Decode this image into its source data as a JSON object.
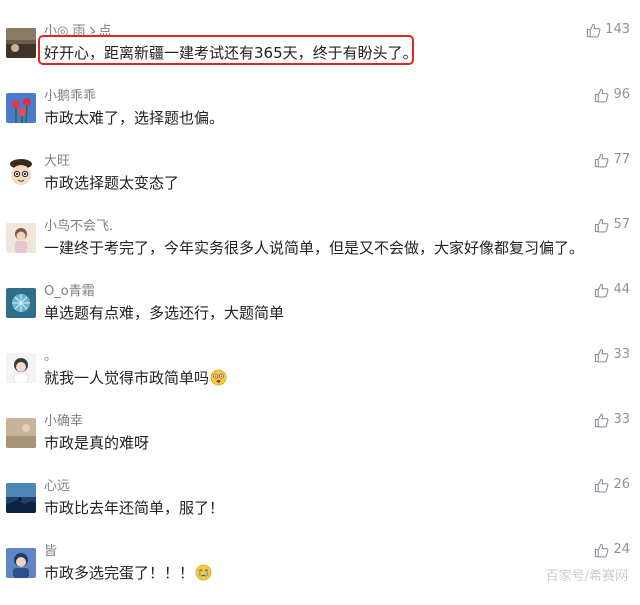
{
  "comments": [
    {
      "username": "小◎ 雨ゝ点",
      "text": "好开心，距离新疆一建考试还有365天，终于有盼头了。",
      "likes": "143"
    },
    {
      "username": "小鹅乖乖",
      "text": "市政太难了，选择题也偏。",
      "likes": "96"
    },
    {
      "username": "大旺",
      "text": "市政选择题太变态了",
      "likes": "77"
    },
    {
      "username": "小鸟不会飞.",
      "text": "一建终于考完了，今年实务很多人说简单，但是又不会做，大家好像都复习偏了。",
      "likes": "57"
    },
    {
      "username": "O_o青霜",
      "text": "单选题有点难，多选还行，大题简单",
      "likes": "44"
    },
    {
      "username": "。",
      "text": "就我一人觉得市政简单吗",
      "likes": "33"
    },
    {
      "username": "小确幸",
      "text": "市政是真的难呀",
      "likes": "33"
    },
    {
      "username": "心远",
      "text": "市政比去年还简单，服了！",
      "likes": "26"
    },
    {
      "username": "皆",
      "text": "市政多选完蛋了！！！",
      "likes": "24"
    }
  ],
  "icons": {
    "like": "thumbs-up-icon",
    "emoji_1": "dizzy-face-emoji-icon",
    "emoji_2": "crying-face-emoji-icon"
  },
  "colors": {
    "highlight_border": "#e0271f",
    "username": "#7a7f8a",
    "text": "#222222",
    "likes": "#8d939e"
  },
  "watermark": "百家号/希赛网"
}
